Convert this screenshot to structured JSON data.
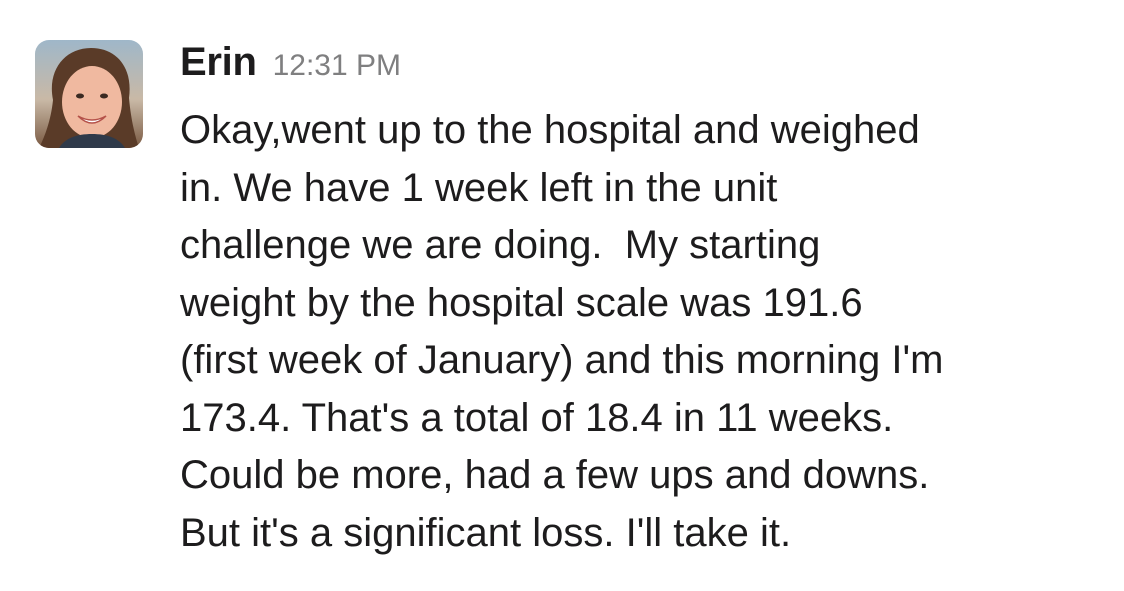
{
  "message": {
    "sender": "Erin",
    "timestamp": "12:31 PM",
    "avatar_icon": "user-avatar-photo",
    "lines": [
      "Okay,went up to the hospital and weighed",
      "in. We have 1 week left in the unit",
      "challenge we are doing.  My starting",
      "weight by the hospital scale was 191.6",
      "(first week of January) and this morning I'm",
      "173.4. That's a total of 18.4 in 11 weeks.",
      "Could be more, had a few ups and downs.",
      "But it's a significant loss. I'll take it."
    ]
  },
  "colors": {
    "text": "#1d1c1d",
    "timestamp": "#7f7f80",
    "background": "#ffffff"
  }
}
